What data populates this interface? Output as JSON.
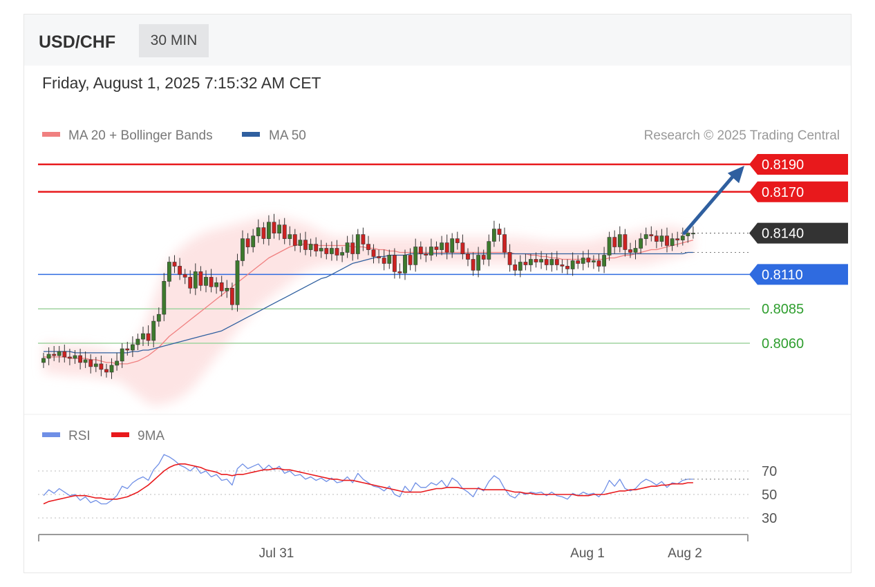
{
  "header": {
    "symbol": "USD/CHF",
    "timeframe": "30 MIN",
    "datetime": "Friday, August 1, 2025 7:15:32 AM CET"
  },
  "legend": {
    "items": [
      {
        "label": "MA 20 + Bollinger Bands",
        "color": "#f08080"
      },
      {
        "label": "MA 50",
        "color": "#2f5f9f"
      }
    ],
    "copyright": "Research © 2025 Trading Central"
  },
  "rsi_legend": {
    "items": [
      {
        "label": "RSI",
        "color": "#6f8fe6"
      },
      {
        "label": "9MA",
        "color": "#e8191c"
      }
    ]
  },
  "colors": {
    "resistance": "#e8191c",
    "pivot": "#2f6be0",
    "support": "#2e9e2e",
    "current": "#333333",
    "bull": "#3d7a2d",
    "bear": "#cc2222",
    "band": "#fde3e3",
    "arrow": "#2f5f9f"
  },
  "chart_data": [
    {
      "type": "candlestick",
      "ylim": [
        0.8015,
        0.8205
      ],
      "levels": [
        {
          "value": 0.819,
          "label": "0.8190",
          "kind": "resistance"
        },
        {
          "value": 0.817,
          "label": "0.8170",
          "kind": "resistance"
        },
        {
          "value": 0.814,
          "label": "0.8140",
          "kind": "current"
        },
        {
          "value": 0.811,
          "label": "0.8110",
          "kind": "pivot"
        },
        {
          "value": 0.8085,
          "label": "0.8085",
          "kind": "support"
        },
        {
          "value": 0.806,
          "label": "0.8060",
          "kind": "support"
        }
      ],
      "x_ticks": [
        "Jul 31",
        "Aug 1",
        "Aug 2"
      ],
      "close": [
        0.8049,
        0.8052,
        0.8051,
        0.8054,
        0.805,
        0.8049,
        0.8051,
        0.8046,
        0.8048,
        0.8043,
        0.8045,
        0.8041,
        0.8039,
        0.8044,
        0.8047,
        0.8056,
        0.8055,
        0.8059,
        0.8063,
        0.8067,
        0.8062,
        0.8076,
        0.8081,
        0.8105,
        0.8119,
        0.8116,
        0.811,
        0.8108,
        0.81,
        0.8112,
        0.8102,
        0.8108,
        0.8101,
        0.8104,
        0.8098,
        0.81,
        0.8088,
        0.812,
        0.8136,
        0.813,
        0.8138,
        0.8144,
        0.8136,
        0.8148,
        0.814,
        0.8146,
        0.8136,
        0.8139,
        0.8131,
        0.8135,
        0.8128,
        0.8132,
        0.8127,
        0.8129,
        0.8125,
        0.8129,
        0.8124,
        0.8126,
        0.8133,
        0.8125,
        0.8139,
        0.8132,
        0.8128,
        0.8123,
        0.8122,
        0.8118,
        0.8124,
        0.8112,
        0.8111,
        0.8124,
        0.8117,
        0.813,
        0.8125,
        0.8124,
        0.813,
        0.8128,
        0.8133,
        0.8126,
        0.8136,
        0.8133,
        0.8125,
        0.8121,
        0.8113,
        0.8124,
        0.8121,
        0.8134,
        0.8143,
        0.8139,
        0.8126,
        0.8117,
        0.8113,
        0.8119,
        0.8117,
        0.8121,
        0.8119,
        0.8121,
        0.8117,
        0.8121,
        0.8117,
        0.8116,
        0.8114,
        0.812,
        0.8118,
        0.8122,
        0.8119,
        0.812,
        0.8116,
        0.8124,
        0.8137,
        0.813,
        0.8139,
        0.8128,
        0.8126,
        0.8129,
        0.8136,
        0.8139,
        0.8138,
        0.8134,
        0.8138,
        0.8131,
        0.8136,
        0.8135,
        0.8138,
        0.814,
        0.814
      ],
      "bb_upper": [
        0.806,
        0.806,
        0.8059,
        0.8059,
        0.8058,
        0.8058,
        0.8058,
        0.8058,
        0.8058,
        0.8057,
        0.8057,
        0.8056,
        0.8055,
        0.8053,
        0.8051,
        0.8052,
        0.8055,
        0.8059,
        0.8064,
        0.807,
        0.808,
        0.8092,
        0.8102,
        0.8113,
        0.812,
        0.8125,
        0.8129,
        0.8132,
        0.8135,
        0.8137,
        0.8139,
        0.8141,
        0.8142,
        0.8143,
        0.8144,
        0.8145,
        0.8146,
        0.8147,
        0.8148,
        0.8149,
        0.815,
        0.8151,
        0.8152,
        0.8152,
        0.8152,
        0.8152,
        0.8151,
        0.815,
        0.8149,
        0.8148,
        0.8147,
        0.8145,
        0.8143,
        0.8141,
        0.8139,
        0.8138,
        0.8137,
        0.8137,
        0.8137,
        0.8137,
        0.8137,
        0.8137,
        0.8137,
        0.8137,
        0.8137,
        0.8137,
        0.8137,
        0.8137,
        0.8137,
        0.8137,
        0.8137,
        0.8137,
        0.8137,
        0.8137,
        0.8137,
        0.8137,
        0.8137,
        0.8137,
        0.8137,
        0.8137,
        0.8137,
        0.8137,
        0.8137,
        0.8137,
        0.8137,
        0.8137,
        0.8137,
        0.8137,
        0.8137,
        0.8137,
        0.8137,
        0.8137,
        0.8136,
        0.8136,
        0.8135,
        0.8135,
        0.8134,
        0.8134,
        0.8134,
        0.8134,
        0.8134,
        0.8134,
        0.8134,
        0.8134,
        0.8134,
        0.8135,
        0.8136,
        0.8137,
        0.8138,
        0.8139,
        0.8139,
        0.814,
        0.814,
        0.8141,
        0.8142,
        0.8143,
        0.8144,
        0.8144,
        0.8145,
        0.8145,
        0.8145,
        0.8144,
        0.8143,
        0.8142,
        0.8141
      ],
      "bb_lower": [
        0.8038,
        0.8038,
        0.8038,
        0.8037,
        0.8037,
        0.8036,
        0.8036,
        0.8036,
        0.8036,
        0.8035,
        0.8035,
        0.8034,
        0.8034,
        0.8033,
        0.8033,
        0.8031,
        0.8028,
        0.8025,
        0.8022,
        0.8019,
        0.8016,
        0.8015,
        0.8015,
        0.8016,
        0.8017,
        0.8018,
        0.802,
        0.8023,
        0.8026,
        0.803,
        0.8035,
        0.804,
        0.8045,
        0.805,
        0.8055,
        0.806,
        0.8065,
        0.807,
        0.8074,
        0.8078,
        0.8082,
        0.8086,
        0.8089,
        0.8092,
        0.8095,
        0.8098,
        0.8101,
        0.8104,
        0.8107,
        0.811,
        0.8112,
        0.8114,
        0.8115,
        0.8116,
        0.8117,
        0.8117,
        0.8117,
        0.8117,
        0.8117,
        0.8117,
        0.8117,
        0.8117,
        0.8117,
        0.8117,
        0.8117,
        0.8117,
        0.8117,
        0.8117,
        0.8117,
        0.8117,
        0.8117,
        0.8117,
        0.8117,
        0.8117,
        0.8117,
        0.8117,
        0.8117,
        0.8117,
        0.8117,
        0.8117,
        0.8117,
        0.8117,
        0.8117,
        0.8117,
        0.8117,
        0.8117,
        0.8117,
        0.8117,
        0.8117,
        0.8117,
        0.8117,
        0.8117,
        0.8117,
        0.8117,
        0.8117,
        0.8117,
        0.8117,
        0.8117,
        0.8117,
        0.8117,
        0.8117,
        0.8117,
        0.8117,
        0.8117,
        0.8117,
        0.8117,
        0.8117,
        0.8117,
        0.8117,
        0.8117,
        0.8117,
        0.8117,
        0.8117,
        0.8117,
        0.8117,
        0.8117,
        0.8118,
        0.8119,
        0.812,
        0.8121,
        0.8122,
        0.8123,
        0.8124,
        0.8125,
        0.8126
      ],
      "ma20": [
        0.805,
        0.805,
        0.805,
        0.805,
        0.805,
        0.8049,
        0.8049,
        0.8049,
        0.8049,
        0.8048,
        0.8048,
        0.8047,
        0.8046,
        0.8046,
        0.8045,
        0.8045,
        0.8045,
        0.8046,
        0.8047,
        0.8049,
        0.8051,
        0.8054,
        0.8057,
        0.8061,
        0.8065,
        0.8068,
        0.8071,
        0.8074,
        0.8077,
        0.808,
        0.8083,
        0.8086,
        0.8089,
        0.8092,
        0.8095,
        0.8098,
        0.8101,
        0.8104,
        0.8107,
        0.811,
        0.8113,
        0.8116,
        0.8119,
        0.8122,
        0.8124,
        0.8126,
        0.8128,
        0.813,
        0.8131,
        0.8132,
        0.8132,
        0.8132,
        0.8131,
        0.8131,
        0.8131,
        0.8131,
        0.8131,
        0.8131,
        0.8131,
        0.813,
        0.813,
        0.813,
        0.8129,
        0.8129,
        0.8128,
        0.8128,
        0.8127,
        0.8127,
        0.8126,
        0.8126,
        0.8126,
        0.8126,
        0.8126,
        0.8126,
        0.8126,
        0.8126,
        0.8126,
        0.8126,
        0.8126,
        0.8126,
        0.8126,
        0.8126,
        0.8126,
        0.8126,
        0.8126,
        0.8126,
        0.8126,
        0.8126,
        0.8126,
        0.8126,
        0.8125,
        0.8125,
        0.8125,
        0.8124,
        0.8124,
        0.8123,
        0.8123,
        0.8122,
        0.8122,
        0.8121,
        0.8121,
        0.8121,
        0.8121,
        0.8121,
        0.8121,
        0.8121,
        0.8121,
        0.8121,
        0.8122,
        0.8122,
        0.8123,
        0.8124,
        0.8124,
        0.8125,
        0.8126,
        0.8127,
        0.8128,
        0.8128,
        0.8129,
        0.813,
        0.8131,
        0.8132,
        0.8133,
        0.8134,
        0.8135
      ],
      "ma50": [
        0.8054,
        0.8054,
        0.8054,
        0.8054,
        0.8054,
        0.8054,
        0.8053,
        0.8053,
        0.8053,
        0.8053,
        0.8053,
        0.8053,
        0.8053,
        0.8053,
        0.8053,
        0.8053,
        0.8053,
        0.8054,
        0.8054,
        0.8055,
        0.8055,
        0.8056,
        0.8057,
        0.8058,
        0.8059,
        0.806,
        0.8061,
        0.8062,
        0.8063,
        0.8064,
        0.8065,
        0.8066,
        0.8067,
        0.8068,
        0.8069,
        0.8071,
        0.8073,
        0.8075,
        0.8077,
        0.8079,
        0.8081,
        0.8083,
        0.8085,
        0.8087,
        0.8089,
        0.8091,
        0.8093,
        0.8095,
        0.8097,
        0.8099,
        0.8101,
        0.8103,
        0.8105,
        0.8107,
        0.8108,
        0.811,
        0.8112,
        0.8114,
        0.8116,
        0.8118,
        0.8119,
        0.812,
        0.8121,
        0.8122,
        0.8123,
        0.8123,
        0.8124,
        0.8124,
        0.8124,
        0.8124,
        0.8125,
        0.8125,
        0.8125,
        0.8125,
        0.8125,
        0.8125,
        0.8125,
        0.8125,
        0.8125,
        0.8125,
        0.8125,
        0.8125,
        0.8125,
        0.8125,
        0.8125,
        0.8125,
        0.8125,
        0.8125,
        0.8125,
        0.8125,
        0.8125,
        0.8125,
        0.8125,
        0.8125,
        0.8125,
        0.8125,
        0.8125,
        0.8125,
        0.8125,
        0.8125,
        0.8125,
        0.8125,
        0.8125,
        0.8125,
        0.8125,
        0.8125,
        0.8125,
        0.8125,
        0.8125,
        0.8125,
        0.8125,
        0.8125,
        0.8125,
        0.8125,
        0.8125,
        0.8125,
        0.8125,
        0.8125,
        0.8125,
        0.8125,
        0.8125,
        0.8125,
        0.8125,
        0.8126,
        0.8126
      ]
    },
    {
      "type": "line",
      "ylim": [
        20,
        90
      ],
      "y_ticks": [
        70,
        50,
        30
      ],
      "series": [
        {
          "name": "RSI",
          "values": [
            49,
            54,
            51,
            55,
            52,
            49,
            50,
            45,
            48,
            43,
            45,
            42,
            42,
            45,
            49,
            57,
            55,
            60,
            63,
            65,
            62,
            71,
            76,
            84,
            82,
            79,
            75,
            73,
            70,
            74,
            68,
            70,
            65,
            67,
            62,
            63,
            58,
            72,
            76,
            72,
            74,
            76,
            71,
            75,
            71,
            74,
            68,
            70,
            66,
            67,
            63,
            65,
            62,
            64,
            61,
            64,
            60,
            61,
            65,
            60,
            68,
            63,
            60,
            57,
            56,
            53,
            57,
            50,
            48,
            57,
            52,
            60,
            56,
            56,
            60,
            58,
            62,
            56,
            64,
            61,
            55,
            52,
            48,
            56,
            53,
            61,
            66,
            63,
            55,
            49,
            47,
            52,
            50,
            52,
            51,
            52,
            49,
            52,
            49,
            48,
            46,
            51,
            49,
            52,
            50,
            51,
            48,
            53,
            62,
            57,
            63,
            55,
            53,
            55,
            60,
            63,
            61,
            58,
            61,
            56,
            60,
            59,
            62,
            63,
            63
          ]
        },
        {
          "name": "9MA",
          "values": [
            42,
            44,
            45,
            46,
            47,
            48,
            49,
            49,
            49,
            48,
            47,
            47,
            46,
            46,
            46,
            47,
            48,
            50,
            52,
            55,
            58,
            62,
            66,
            70,
            73,
            75,
            76,
            76,
            75,
            74,
            73,
            71,
            70,
            69,
            67,
            67,
            66,
            67,
            67,
            68,
            69,
            70,
            71,
            71,
            72,
            72,
            71,
            71,
            70,
            69,
            68,
            67,
            66,
            65,
            64,
            63,
            63,
            62,
            62,
            62,
            61,
            60,
            59,
            58,
            57,
            56,
            55,
            54,
            53,
            52,
            52,
            52,
            52,
            53,
            54,
            55,
            55,
            56,
            56,
            56,
            55,
            55,
            55,
            55,
            54,
            54,
            54,
            54,
            54,
            53,
            52,
            52,
            51,
            51,
            50,
            50,
            50,
            50,
            50,
            50,
            50,
            50,
            49,
            49,
            49,
            50,
            50,
            50,
            51,
            52,
            53,
            53,
            54,
            54,
            55,
            56,
            57,
            57,
            58,
            58,
            59,
            59,
            59,
            60,
            60
          ]
        }
      ]
    }
  ]
}
